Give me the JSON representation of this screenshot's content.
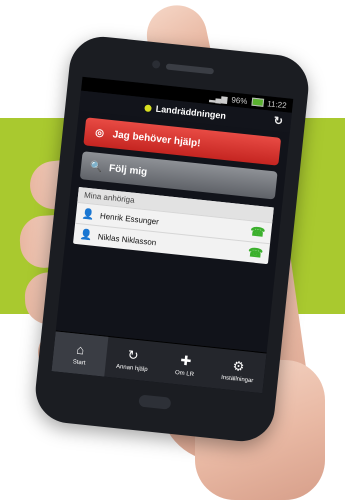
{
  "status_bar": {
    "time": "11:22",
    "battery": "96%"
  },
  "app": {
    "title": "Landräddningen",
    "brand_color": "#d8e020"
  },
  "actions": {
    "help_label": "Jag behöver hjälp!",
    "follow_label": "Följ mig",
    "help_color": "#d9332e"
  },
  "relatives": {
    "header": "Mina anhöriga",
    "items": [
      {
        "name": "Henrik Essunger"
      },
      {
        "name": "Niklas Niklasson"
      }
    ]
  },
  "tabs": [
    {
      "label": "Start",
      "icon": "home-icon",
      "active": true
    },
    {
      "label": "Annan hjälp",
      "icon": "loop-icon",
      "active": false
    },
    {
      "label": "Om LR",
      "icon": "plus-icon",
      "active": false
    },
    {
      "label": "Inställningar",
      "icon": "gear-icon",
      "active": false
    }
  ],
  "colors": {
    "background_band": "#a9c92f"
  }
}
